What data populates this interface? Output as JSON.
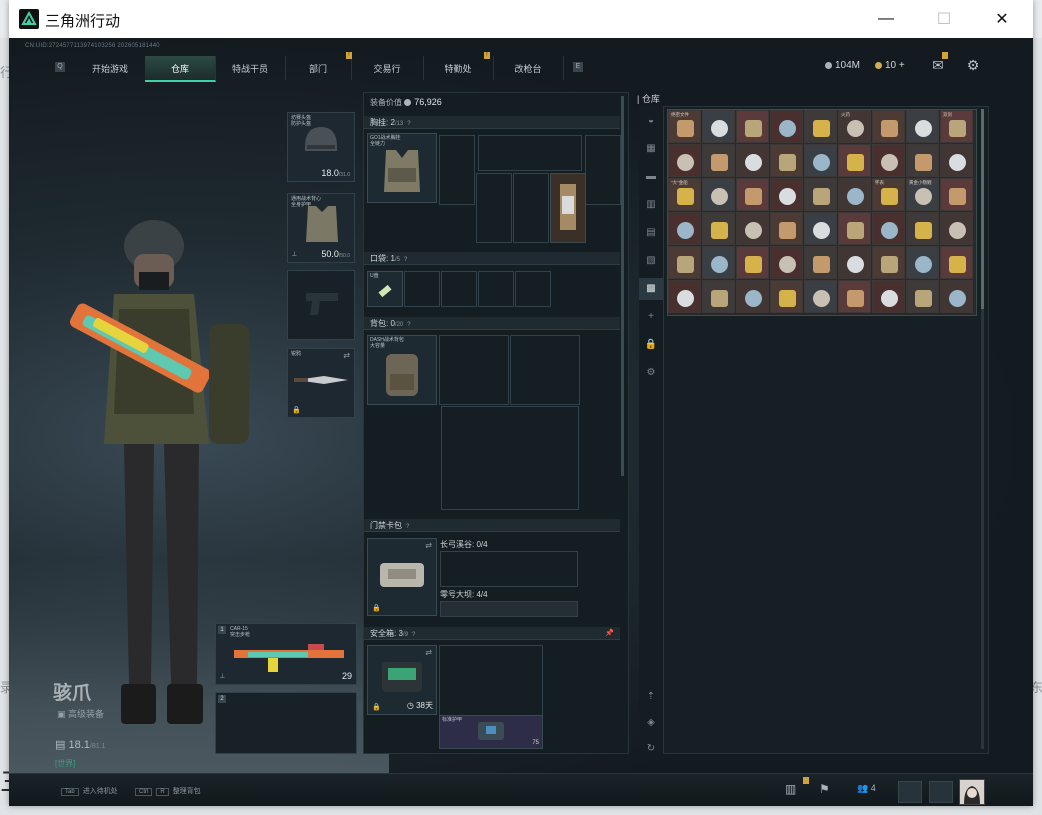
{
  "window": {
    "title": "三角洲行动",
    "min": "—",
    "max": "☐",
    "close": "✕"
  },
  "uid": "CN:UID:2724577113974103256 202605181440",
  "nav": {
    "tabs": [
      {
        "label": "开始游戏"
      },
      {
        "label": "仓库",
        "active": true
      },
      {
        "label": "特战干员"
      },
      {
        "label": "部门",
        "badge": "!"
      },
      {
        "label": "交易行"
      },
      {
        "label": "特勤处",
        "badge": "!"
      },
      {
        "label": "改枪台"
      }
    ],
    "left_key": "Q",
    "right_key": "E"
  },
  "currency": {
    "silver": "104M",
    "gold": "10",
    "gold_add": "+"
  },
  "character": {
    "name": "骇爪",
    "equipment_label": "高级装备",
    "level": "18.1",
    "level_max": "/81.1",
    "channel": "[世界]"
  },
  "gear": {
    "helmet": {
      "name": "坊赛头盔\n防护头盔",
      "durability": "18.0",
      "durability_max": "/31.0"
    },
    "armor": {
      "name": "通用战术背心\n全身护甲",
      "durability": "50.0",
      "durability_max": "/50.0"
    },
    "melee": {
      "name": "锐鸦"
    },
    "primary": {
      "name": "CAR-15\n突击步枪",
      "ammo": "29",
      "slot": "1"
    },
    "secondary": {
      "slot": "2"
    }
  },
  "loadout": {
    "value_label": "装备价值",
    "value": "76,926",
    "chest_label": "胸挂:",
    "chest_count": "2",
    "chest_max": "/13",
    "chest_item": "GO1战术胸挂\n全链力",
    "pocket_label": "口袋:",
    "pocket_count": "1",
    "pocket_max": "/5",
    "pocket_item": "U盘",
    "backpack_label": "背包:",
    "backpack_count": "0",
    "backpack_max": "/20",
    "backpack_item": "DASH战术背包\n大容量",
    "keycard_label": "门禁卡包",
    "keycard_line1": "长弓溪谷: 0/4",
    "keycard_line2": "零号大坝: 4/4",
    "safebox_label": "安全箱:",
    "safebox_count": "3",
    "safebox_max": "/9",
    "safebox_days": "38天",
    "safebox_item": "标准护甲",
    "safebox_item_count": "75"
  },
  "warehouse": {
    "title": "仓库",
    "nav_icons": [
      "helmet-tab",
      "armor-tab",
      "weapon-tab",
      "ammo-tab",
      "medical-tab",
      "container-tab",
      "collection-tab",
      "add-tab",
      "lock-tab",
      "settings-tab"
    ],
    "items_row1": [
      "",
      "",
      "",
      "",
      "",
      "",
      "",
      "",
      ""
    ],
    "items": [
      "绝密文件",
      "",
      "",
      "",
      "",
      "火药",
      "",
      "",
      "双剑",
      "",
      "",
      "",
      "",
      "",
      "",
      "",
      "",
      "",
      "\"大\"金船",
      "",
      "",
      "",
      "",
      "",
      "怀表",
      "黄金小锦鲤",
      "",
      "",
      "",
      "",
      "",
      "",
      "",
      "",
      "",
      "",
      "",
      "",
      ""
    ]
  },
  "bottom": {
    "tab_key": "Tab",
    "tab_hint": "进入待机处",
    "ctrl_key": "Ctrl",
    "r_key": "R",
    "ctrl_hint": "整理背包",
    "friends_count": "4"
  },
  "colors": {
    "accent": "#3fd0a8",
    "panel": "#141d22",
    "gold_bg": "#2b2a2a",
    "badge": "#d3a33a"
  }
}
